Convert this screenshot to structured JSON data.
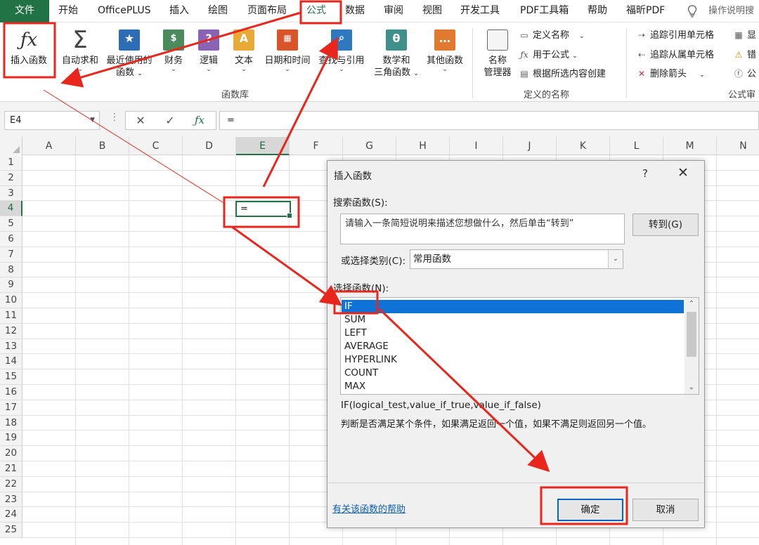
{
  "menu": {
    "tabs": [
      "文件",
      "开始",
      "OfficePLUS",
      "插入",
      "绘图",
      "页面布局",
      "公式",
      "数据",
      "审阅",
      "视图",
      "开发工具",
      "PDF工具箱",
      "帮助",
      "福昕PDF"
    ],
    "active_tab": "公式",
    "tell_me": "操作说明搜"
  },
  "ribbon": {
    "insert_function": "插入函数",
    "autosum": "自动求和",
    "recent": [
      "最近使用的",
      "函数"
    ],
    "financial": "财务",
    "logical": "逻辑",
    "text": "文本",
    "datetime": "日期和时间",
    "lookup": "查找与引用",
    "math": [
      "数学和",
      "三角函数"
    ],
    "other": "其他函数",
    "library_label": "函数库",
    "name_manager": [
      "名称",
      "管理器"
    ],
    "define_name": "定义名称",
    "use_in_formula": "用于公式",
    "create_from_selection": "根据所选内容创建",
    "defined_names_label": "定义的名称",
    "trace_precedents": "追踪引用单元格",
    "trace_dependents": "追踪从属单元格",
    "remove_arrows": "删除箭头",
    "show_formulas": "显",
    "error_check": "错",
    "evaluate": "公",
    "auditing_label": "公式审"
  },
  "formula_bar": {
    "name_box": "E4",
    "formula": "="
  },
  "grid": {
    "columns": [
      "A",
      "B",
      "C",
      "D",
      "E",
      "F",
      "G",
      "H",
      "I",
      "J",
      "K",
      "L",
      "M",
      "N"
    ],
    "rows": [
      "1",
      "2",
      "3",
      "4",
      "5",
      "6",
      "7",
      "8",
      "9",
      "10",
      "11",
      "12",
      "13",
      "14",
      "15",
      "16",
      "17",
      "18",
      "19",
      "20",
      "21",
      "22",
      "23",
      "24",
      "25"
    ],
    "active_column": "E",
    "active_row": "4",
    "active_cell_value": "="
  },
  "dialog": {
    "title": "插入函数",
    "help_glyph": "?",
    "close_glyph": "✕",
    "search_label": "搜索函数(S):",
    "search_value": "请输入一条简短说明来描述您想做什么，然后单击“转到”",
    "go_button": "转到(G)",
    "category_label": "或选择类别(C):",
    "category_value": "常用函数",
    "select_label": "选择函数(N):",
    "functions": [
      "IF",
      "SUM",
      "LEFT",
      "AVERAGE",
      "HYPERLINK",
      "COUNT",
      "MAX"
    ],
    "selected_function": "IF",
    "syntax": "IF(logical_test,value_if_true,value_if_false)",
    "description": "判断是否满足某个条件，如果满足返回一个值，如果不满足则返回另一个值。",
    "help_link": "有关该函数的帮助",
    "ok": "确定",
    "cancel": "取消"
  },
  "colors": {
    "excel_green": "#217346",
    "annotation_red": "#e8261c",
    "selection_blue": "#0f72d6"
  }
}
